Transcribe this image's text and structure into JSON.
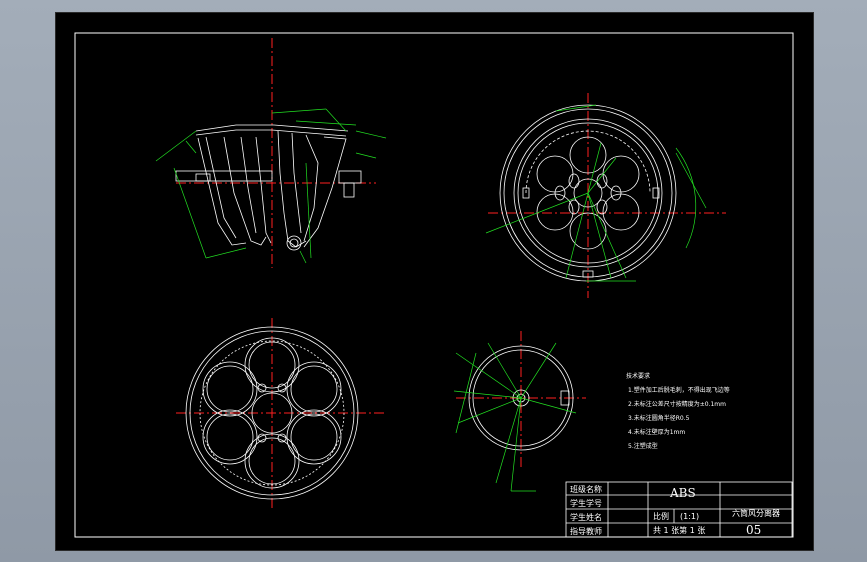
{
  "title_block": {
    "labels": [
      "班级名称",
      "学生学号",
      "学生姓名",
      "指导教师"
    ],
    "material": "ABS",
    "scale_label": "比例",
    "scale_value": "(1:1)",
    "sheet_info": "共 1 张第 1 张",
    "part_name": "六筒风分离器",
    "drawing_number": "05"
  },
  "tech_notes": {
    "heading": "技术要求",
    "items": [
      "1.塑件加工后脱毛刺，不得出现飞边等",
      "2.未标注公差尺寸按精度为±0.1mm",
      "3.未标注圆角半径R0.5",
      "4.未标注壁厚为1mm",
      "5.注塑成型"
    ]
  },
  "colors": {
    "background": "#000000",
    "outline": "#ffffff",
    "centerline": "#ff2020",
    "dimension": "#22e022"
  }
}
